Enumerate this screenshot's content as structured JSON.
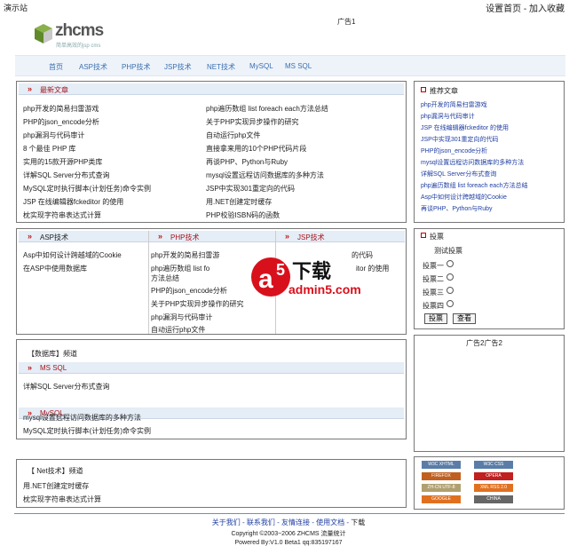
{
  "header": {
    "site_name": "演示站",
    "home_link": "设置首页",
    "fav_link": "加入收藏",
    "ad1": "广告1"
  },
  "logo": {
    "brand": "zhcms",
    "tagline": "简单高效的jsp cms"
  },
  "nav": [
    "首页",
    "ASP技术",
    "PHP技术",
    "JSP技术",
    "NET技术",
    "MySQL",
    "MS SQL"
  ],
  "latest": {
    "title": "最新文章",
    "left": [
      "php开发的简易扫雷游戏",
      "PHP的json_encode分析",
      "php漏洞与代码审计",
      "8 个最佳 PHP 库",
      "实用的15款开源PHP类库",
      "详解SQL Server分布式查询",
      "MySQL定时执行脚本(计划任务)命令实例",
      "JSP 在线编辑器fckeditor 的使用",
      "枕实现字符串表达式计算"
    ],
    "right": [
      "php遍历数组 list foreach each方法总结",
      "关于PHP实现异步操作的研究",
      "自动运行php文件",
      "直接拿来用的10个PHP代码片段",
      "再谈PHP、Python与Ruby",
      "mysql设置远程访问数据库的多种方法",
      "JSP中实现301重定向的代码",
      "用.NET创建定时缓存",
      "PHP校验ISBN码的函数"
    ]
  },
  "recommend": {
    "title": "推荐文章",
    "items": [
      "php开发的简易扫雷游戏",
      "php漏洞与代码审计",
      "JSP 在线编辑器fckeditor 的使用",
      "JSP中实现301重定向的代码",
      "PHP的json_encode分析",
      "mysql设置远程访问数据库的多种方法",
      "详解SQL Server分布式查询",
      "php遍历数组 list foreach each方法总结",
      "Asp中如何设计跨越域的Cookie",
      "再谈PHP、Python与Ruby"
    ]
  },
  "asp": {
    "title": "ASP技术",
    "items": [
      "Asp中如何设计跨越域的Cookie",
      "在ASP中使用数据库"
    ]
  },
  "php": {
    "title": "PHP技术",
    "items": [
      "php开发的简易扫雷游",
      "php遍历数组 list fo",
      "方法总结",
      "PHP的json_encode分析",
      "关于PHP实现异步操作的研究",
      "php漏洞与代码审计",
      "自动运行php文件"
    ]
  },
  "jsp": {
    "title": "JSP技术",
    "items": [
      "的代码",
      "itor 的使用"
    ]
  },
  "watermark": {
    "main": "下载",
    "site": "admin5.com"
  },
  "vote": {
    "title": "投票",
    "question": "测试投票",
    "options": [
      "投票一",
      "投票二",
      "投票三",
      "投票四"
    ],
    "submit": "投票",
    "view": "查看"
  },
  "ad2": "广告2广告2",
  "db": {
    "title": "【数据库】频道",
    "mssql": "MS SQL",
    "mssql_items": [
      "详解SQL Server分布式查询"
    ],
    "mysql": "MySQL",
    "mysql_items": [
      "mysql设置远程访问数据库的多种方法",
      "MySQL定时执行脚本(计划任务)命令实例"
    ]
  },
  "net": {
    "title": "【 Net技术】频道",
    "items": [
      "用.NET创建定时缓存",
      "枕实现字符串表达式计算"
    ]
  },
  "badges": [
    {
      "label": "W3C XHTML",
      "color": "#5a7da8"
    },
    {
      "label": "W3C CSS",
      "color": "#5a7da8"
    },
    {
      "label": "FIREFOX",
      "color": "#c06020"
    },
    {
      "label": "OPERA",
      "color": "#c02020"
    },
    {
      "label": "ZH-CN UTF-8",
      "color": "#b0a070"
    },
    {
      "label": "XML RSS 2.0",
      "color": "#e07020"
    },
    {
      "label": "GOOGLE SITEMAP",
      "color": "#e07020"
    },
    {
      "label": "CHINA",
      "color": "#666666"
    }
  ],
  "footer": {
    "links": [
      "关于我们",
      "联系我们",
      "友情连接",
      "使用文档",
      "下载"
    ],
    "copyright": "Copyright ©2003~2006 ZHCMS 流量统计",
    "powered": "Powered By:V1.0 Beta1 qq:835197167"
  }
}
